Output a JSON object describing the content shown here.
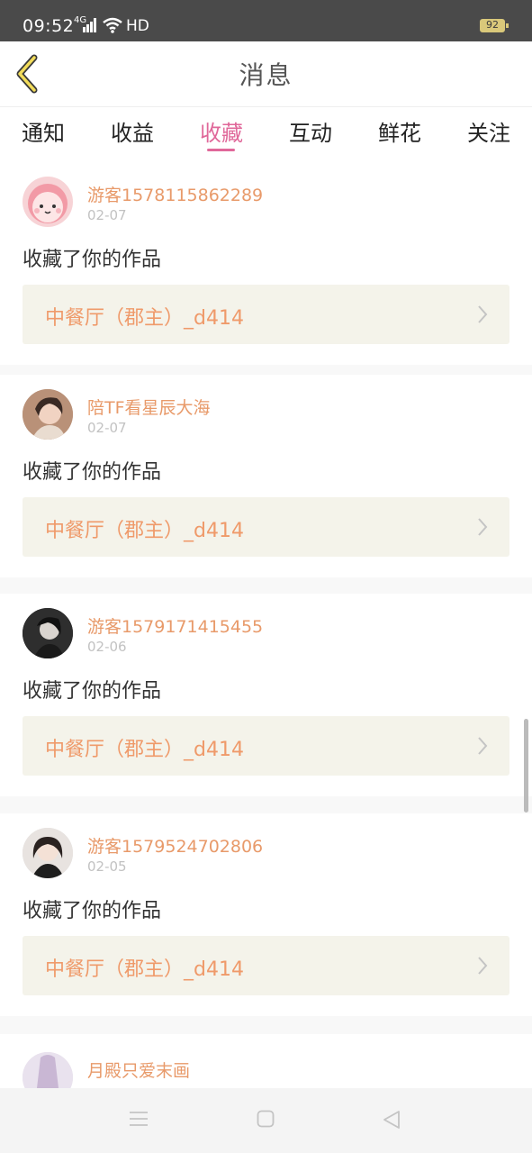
{
  "status_bar": {
    "time": "09:52",
    "network": "4G",
    "hd": "HD",
    "battery": "92"
  },
  "header": {
    "title": "消息",
    "back_icon": "chevron-left-icon"
  },
  "tabs": [
    {
      "label": "通知"
    },
    {
      "label": "收益"
    },
    {
      "label": "收藏",
      "active": true
    },
    {
      "label": "互动"
    },
    {
      "label": "鲜花"
    },
    {
      "label": "关注"
    }
  ],
  "items": [
    {
      "user": "游客1578115862289",
      "date": "02-07",
      "action": "收藏了你的作品",
      "work": "中餐厅（郡主）_d414"
    },
    {
      "user": "陪TF看星辰大海",
      "date": "02-07",
      "action": "收藏了你的作品",
      "work": "中餐厅（郡主）_d414"
    },
    {
      "user": "游客1579171415455",
      "date": "02-06",
      "action": "收藏了你的作品",
      "work": "中餐厅（郡主）_d414"
    },
    {
      "user": "游客1579524702806",
      "date": "02-05",
      "action": "收藏了你的作品",
      "work": "中餐厅（郡主）_d414"
    },
    {
      "user": "月殿只爱末画",
      "date": "",
      "action": "",
      "work": ""
    }
  ],
  "colors": {
    "accent": "#e0689a",
    "username": "#e89a6a",
    "work_title": "#ef9a6a",
    "work_bg": "#f4f3ea"
  },
  "nav_bar": {
    "menu_icon": "menu-icon",
    "home_icon": "square-home-icon",
    "back_icon": "triangle-back-icon"
  }
}
